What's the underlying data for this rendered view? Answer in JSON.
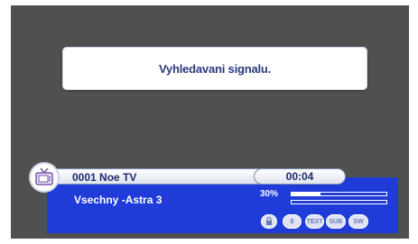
{
  "dialog": {
    "message": "Vyhledavani signalu."
  },
  "channel": {
    "name": "0001 Noe TV",
    "time": "00:04",
    "satellite": "Vsechny -Astra 3"
  },
  "signal": {
    "strength_label": "30%",
    "strength_fraction": 0.3,
    "quality_fraction": 0.0
  },
  "function_icons": [
    {
      "name": "lock-icon",
      "label": ""
    },
    {
      "name": "dollar-icon",
      "label": "$"
    },
    {
      "name": "text-icon",
      "label": "TEXT"
    },
    {
      "name": "subtitle-icon",
      "label": "SUB"
    },
    {
      "name": "switch-icon",
      "label": "SW"
    }
  ],
  "colors": {
    "panel": "#1f3bd8",
    "background": "#505050"
  }
}
